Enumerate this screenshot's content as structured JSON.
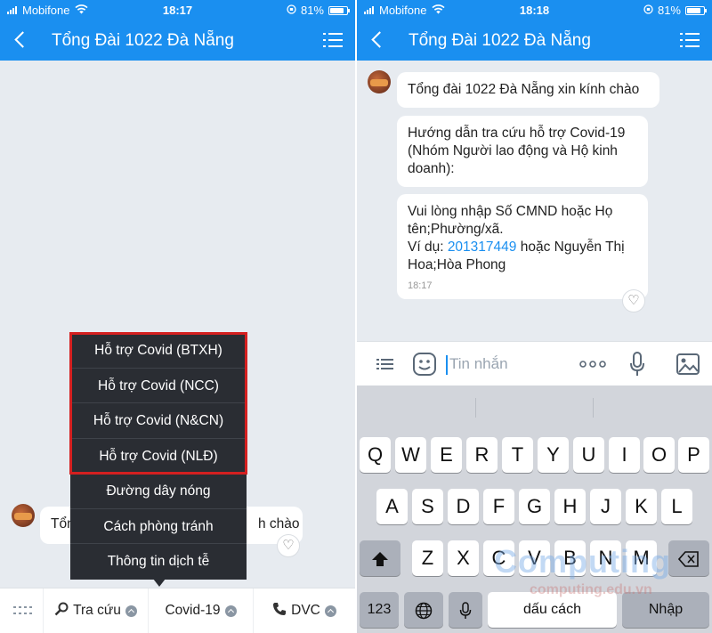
{
  "left": {
    "status": {
      "carrier": "Mobifone",
      "time": "18:17",
      "battery": "81%",
      "battery_level": 0.81
    },
    "title": "Tổng Đài 1022 Đà Nẵng",
    "greeting_fragments": {
      "start": "Tổn",
      "end": "h chào"
    },
    "popup_menu": [
      {
        "label": "Hỗ trợ Covid (BTXH)",
        "highlighted": true
      },
      {
        "label": "Hỗ trợ Covid (NCC)",
        "highlighted": true
      },
      {
        "label": "Hỗ trợ Covid (N&CN)",
        "highlighted": true
      },
      {
        "label": "Hỗ trợ Covid (NLĐ)",
        "highlighted": true
      },
      {
        "label": "Đường dây nóng",
        "highlighted": false
      },
      {
        "label": "Cách phòng tránh",
        "highlighted": false
      },
      {
        "label": "Thông tin dịch tễ",
        "highlighted": false
      }
    ],
    "bottom_bar": {
      "tra_cuu": "Tra cứu",
      "covid": "Covid-19",
      "dvc": "DVC"
    }
  },
  "right": {
    "status": {
      "carrier": "Mobifone",
      "time": "18:18",
      "battery": "81%",
      "battery_level": 0.81
    },
    "title": "Tổng Đài 1022 Đà Nẵng",
    "messages": {
      "m1": "Tổng đài 1022 Đà Nẵng xin kính chào",
      "m2_l1": "Hướng dẫn tra cứu hỗ trợ Covid-19",
      "m2_l2": "(Nhóm Người lao động và Hộ kinh",
      "m2_l3": "doanh):",
      "m3_l1": "Vui lòng nhập Số CMND hoặc Họ",
      "m3_l2": "tên;Phường/xã.",
      "m3_l3a": "Ví dụ: ",
      "m3_link": "201317449",
      "m3_l3b": " hoặc Nguyễn Thị",
      "m3_l4": "Hoa;Hòa Phong",
      "m3_time": "18:17"
    },
    "input_placeholder": "Tin nhắn",
    "keyboard": {
      "row1": [
        "Q",
        "W",
        "E",
        "R",
        "T",
        "Y",
        "U",
        "I",
        "O",
        "P"
      ],
      "row2": [
        "A",
        "S",
        "D",
        "F",
        "G",
        "H",
        "J",
        "K",
        "L"
      ],
      "row3": [
        "Z",
        "X",
        "C",
        "V",
        "B",
        "N",
        "M"
      ],
      "numbers": "123",
      "space": "dấu cách",
      "return": "Nhập"
    }
  },
  "watermark": {
    "big": "Computing",
    "small": "computing.edu.vn"
  },
  "colors": {
    "header": "#1a8ff0",
    "highlight_border": "#d42020",
    "popup_bg": "#2a2d33"
  }
}
